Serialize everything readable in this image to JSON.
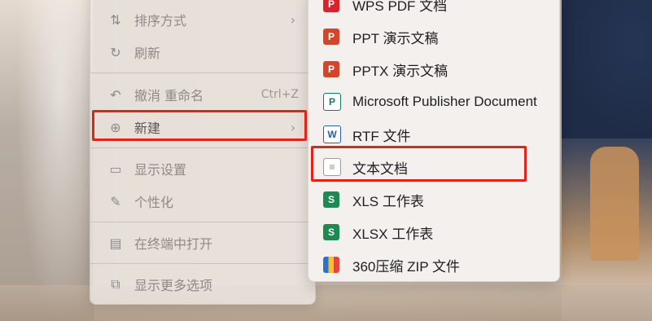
{
  "main_menu": {
    "items": [
      {
        "label": "排序方式",
        "icon": "sort-icon",
        "chevron": "›"
      },
      {
        "label": "刷新",
        "icon": "refresh-icon"
      },
      {
        "label": "撤消 重命名",
        "icon": "undo-icon",
        "shortcut": "Ctrl+Z"
      },
      {
        "label": "新建",
        "icon": "new-plus-icon",
        "chevron": "›"
      },
      {
        "label": "显示设置",
        "icon": "display-settings-icon"
      },
      {
        "label": "个性化",
        "icon": "brush-icon"
      },
      {
        "label": "在终端中打开",
        "icon": "terminal-icon"
      },
      {
        "label": "显示更多选项",
        "icon": "more-options-icon"
      }
    ]
  },
  "sub_menu": {
    "items": [
      {
        "label": "WPS PDF 文档",
        "icon": "wps-pdf-icon",
        "glyph": "P"
      },
      {
        "label": "PPT 演示文稿",
        "icon": "ppt-icon",
        "glyph": "P"
      },
      {
        "label": "PPTX 演示文稿",
        "icon": "pptx-icon",
        "glyph": "P"
      },
      {
        "label": "Microsoft Publisher Document",
        "icon": "publisher-icon",
        "glyph": "P"
      },
      {
        "label": "RTF 文件",
        "icon": "rtf-icon",
        "glyph": "W"
      },
      {
        "label": "文本文档",
        "icon": "text-document-icon",
        "glyph": "≡"
      },
      {
        "label": "XLS 工作表",
        "icon": "xls-icon",
        "glyph": "S"
      },
      {
        "label": "XLSX 工作表",
        "icon": "xlsx-icon",
        "glyph": "S"
      },
      {
        "label": "360压缩 ZIP 文件",
        "icon": "zip-icon",
        "glyph": ""
      }
    ]
  },
  "colors": {
    "highlight": "#e2231a"
  }
}
